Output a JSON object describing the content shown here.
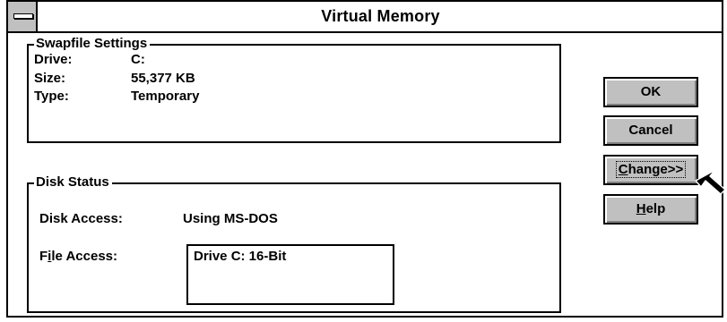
{
  "window": {
    "title": "Virtual Memory",
    "system_menu_icon": "system-menu-icon"
  },
  "swapfile": {
    "legend": "Swapfile Settings",
    "drive_label": "Drive:",
    "drive_value": "C:",
    "size_label": "Size:",
    "size_value": "55,377 KB",
    "type_label": "Type:",
    "type_value": "Temporary"
  },
  "disk_status": {
    "legend": "Disk Status",
    "disk_access_label": "Disk Access:",
    "disk_access_value": "Using MS-DOS",
    "file_access_label_pre": "F",
    "file_access_label_u": "i",
    "file_access_label_post": "le Access:",
    "file_access_items": [
      "Drive C:  16-Bit"
    ]
  },
  "buttons": {
    "ok": "OK",
    "cancel": "Cancel",
    "change_u": "C",
    "change_rest": "hange>>",
    "help_u": "H",
    "help_rest": "elp"
  },
  "cursor": {
    "icon": "arrow-cursor-icon"
  }
}
